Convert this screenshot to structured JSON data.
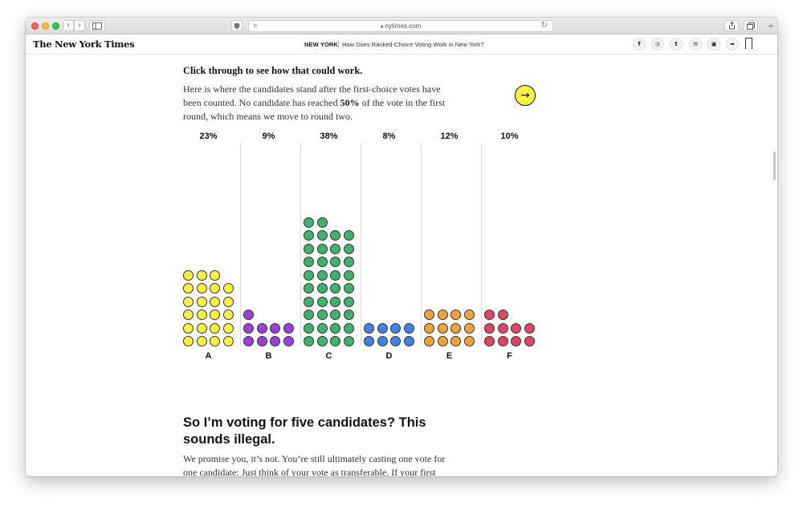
{
  "browser": {
    "url": "nytimes.com",
    "nav_back_icon": "‹",
    "nav_forward_icon": "›"
  },
  "nyt_header": {
    "logo": "The New York Times",
    "section": "NEW YORK",
    "headline": "How Does Ranked-Choice Voting Work in New York?",
    "share_icons": [
      "facebook-icon",
      "whatsapp-icon",
      "twitter-icon",
      "email-icon",
      "gift-icon",
      "share-arrow-icon"
    ],
    "share_glyphs": [
      "f",
      "◎",
      "t",
      "✉",
      "▣",
      "➦"
    ]
  },
  "article": {
    "lead": "Click through to see how that could work.",
    "para_1": "Here is where the candidates stand after the first-choice votes have been counted. No candidate has reached ",
    "para_bold": "50%",
    "para_2": " of the vote in the first round, which means we move to round two.",
    "next_icon": "→",
    "subhead": "So I’m voting for five candidates? This sounds illegal.",
    "body": "We promise you, it’s not. You’re still ultimately casting one vote for one candidate: Just think of your vote as transferable. If your first choice is eliminated, then your vote transfers over to your next"
  },
  "chart_data": {
    "type": "bar",
    "round": 1,
    "categories": [
      "A",
      "B",
      "C",
      "D",
      "E",
      "F"
    ],
    "percent_labels": [
      "23%",
      "9%",
      "38%",
      "8%",
      "12%",
      "10%"
    ],
    "dot_counts": [
      23,
      9,
      38,
      8,
      12,
      10
    ],
    "colors": [
      "#fff23f",
      "#9b3fdc",
      "#3db46a",
      "#3f82e8",
      "#f5a23a",
      "#e04563"
    ]
  }
}
